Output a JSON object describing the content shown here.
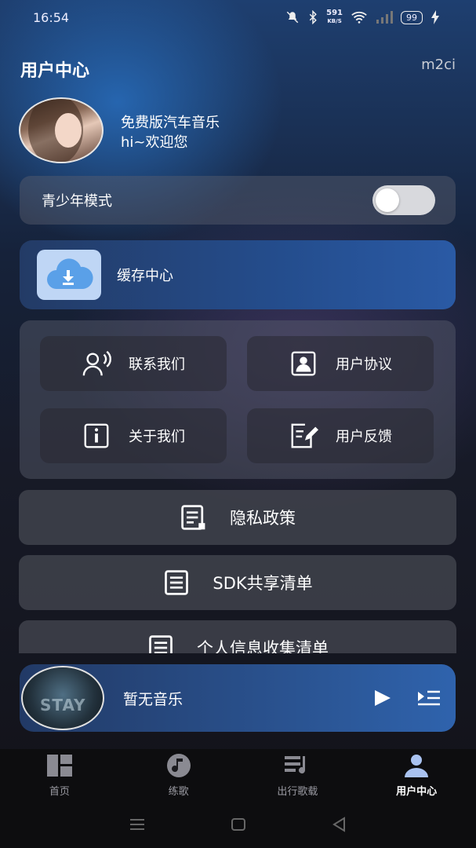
{
  "status_bar": {
    "time": "16:54",
    "net_speed": "591",
    "net_unit": "KB/S",
    "battery": "99"
  },
  "header": {
    "title": "用户中心",
    "right_label": "m2ci"
  },
  "profile": {
    "name": "免费版汽车音乐",
    "greeting": "hi~欢迎您"
  },
  "teen_mode": {
    "label": "青少年模式",
    "enabled": false
  },
  "cache": {
    "label": "缓存中心"
  },
  "grid": {
    "contact": "联系我们",
    "agreement": "用户协议",
    "about": "关于我们",
    "feedback": "用户反馈"
  },
  "list": {
    "privacy": "隐私政策",
    "sdk": "SDK共享清单",
    "personal_info": "个人信息收集清单"
  },
  "player": {
    "title": "暂无音乐",
    "cover_text": "STAY"
  },
  "tabs": [
    {
      "label": "首页",
      "icon": "dashboard-icon",
      "active": false
    },
    {
      "label": "练歌",
      "icon": "music-note-icon",
      "active": false
    },
    {
      "label": "出行歌载",
      "icon": "playlist-icon",
      "active": false
    },
    {
      "label": "用户中心",
      "icon": "user-icon",
      "active": true
    }
  ],
  "colors": {
    "accent_blue": "#2b5696",
    "active_tab_icon": "#a9c2f0"
  }
}
